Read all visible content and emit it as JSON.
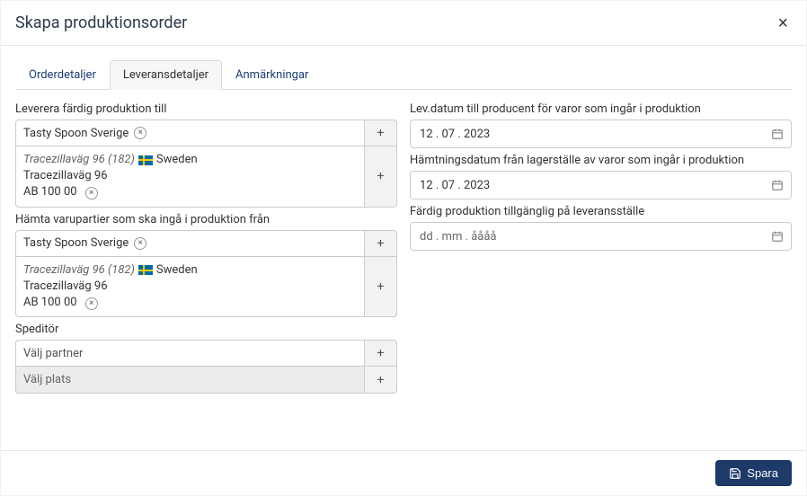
{
  "header": {
    "title": "Skapa produktionsorder",
    "close_label": "×"
  },
  "tabs": [
    {
      "label": "Orderdetaljer",
      "active": false
    },
    {
      "label": "Leveransdetaljer",
      "active": true
    },
    {
      "label": "Anmärkningar",
      "active": false
    }
  ],
  "left": {
    "deliver_to": {
      "label": "Leverera färdig produktion till",
      "partner": "Tasty Spoon Sverige",
      "address": {
        "line1_name": "Tracezillaväg 96 (182)",
        "country": "Sweden",
        "street": "Tracezillaväg 96",
        "postal": "AB 100 00"
      }
    },
    "pick_from": {
      "label": "Hämta varupartier som ska ingå i produktion från",
      "partner": "Tasty Spoon Sverige",
      "address": {
        "line1_name": "Tracezillaväg 96 (182)",
        "country": "Sweden",
        "street": "Tracezillaväg 96",
        "postal": "AB 100 00"
      }
    },
    "speditor": {
      "label": "Speditör",
      "partner_placeholder": "Välj partner",
      "place_placeholder": "Välj plats"
    }
  },
  "right": {
    "delivery_date": {
      "label": "Lev.datum till producent för varor som ingår i produktion",
      "value": "12 . 07 . 2023"
    },
    "pickup_date": {
      "label": "Hämtningsdatum från lagerställe av varor som ingår i produktion",
      "value": "12 . 07 . 2023"
    },
    "available_date": {
      "label": "Färdig produktion tillgänglig på leveransställe",
      "placeholder": "dd . mm . åååå"
    }
  },
  "footer": {
    "save_label": "Spara"
  },
  "glyphs": {
    "plus": "+",
    "x": "×"
  }
}
